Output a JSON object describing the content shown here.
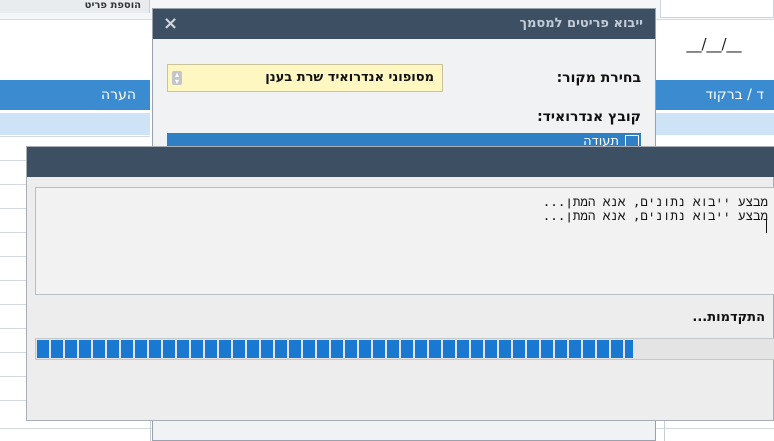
{
  "background": {
    "top_tab": "הוספת פריט",
    "top_center": "",
    "date_field": "__/__/__",
    "table_left_header": "הערה",
    "table_right_header": "ד / ברקוד"
  },
  "import_dialog": {
    "title": "ייבוא פריטים למסמך",
    "close_icon": "×",
    "source_label": "בחירת מקור:",
    "source_value": "מסופוני אנדרואיד שרת בענן",
    "file_label": "קובץ אנדרואיד:",
    "file_column_header": "תעודה"
  },
  "progress_dialog": {
    "title": "",
    "log_lines": [
      "מבצע ייבוא נתונים, אנא המתן...",
      "מבצע ייבוא נתונים, אנא המתן..."
    ],
    "progress_label": "התקדמות...",
    "progress_fraction": 0.81
  }
}
